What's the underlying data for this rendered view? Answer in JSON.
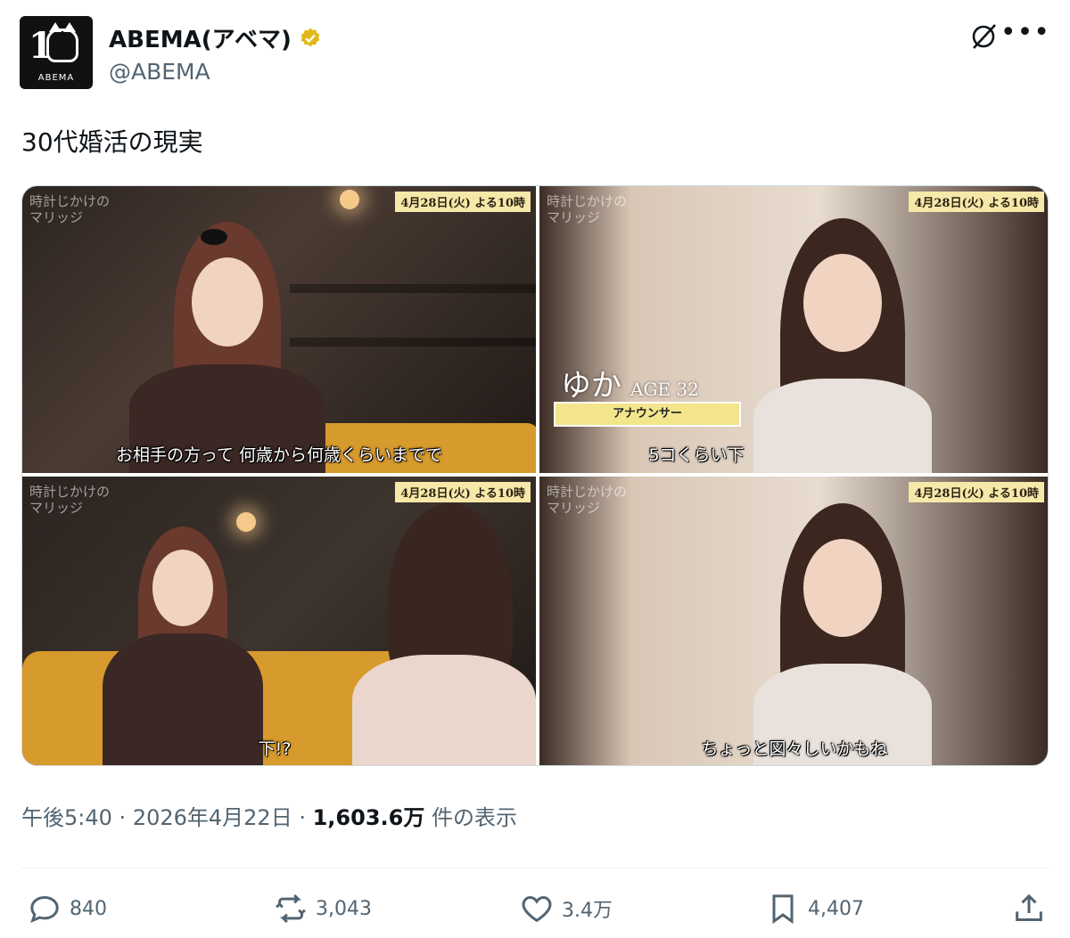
{
  "author": {
    "display_name": "ABEMA(アベマ)",
    "handle": "@ABEMA",
    "avatar_label": "ABEMA",
    "verified_color": "#e2b719"
  },
  "tweet": {
    "text": "30代婚活の現実"
  },
  "media": {
    "frames": [
      {
        "watermark": "時計じかけの\nマリッジ",
        "date_badge": "4月28日(火) よる10時",
        "subtitle": "お相手の方って 何歳から何歳くらいまでで"
      },
      {
        "watermark": "時計じかけの\nマリッジ",
        "date_badge": "4月28日(火) よる10時",
        "name": "ゆか",
        "age": "AGE 32",
        "role": "アナウンサー",
        "subtitle": "5コくらい下"
      },
      {
        "watermark": "時計じかけの\nマリッジ",
        "date_badge": "4月28日(火) よる10時",
        "subtitle": "下!?"
      },
      {
        "watermark": "時計じかけの\nマリッジ",
        "date_badge": "4月28日(火) よる10時",
        "subtitle": "ちょっと図々しいかもね"
      }
    ]
  },
  "meta": {
    "time": "午後5:40",
    "date": "2026年4月22日",
    "views_count": "1,603.6万",
    "views_label": "件の表示"
  },
  "actions": {
    "reply_count": "840",
    "repost_count": "3,043",
    "like_count": "3.4万",
    "bookmark_count": "4,407"
  }
}
